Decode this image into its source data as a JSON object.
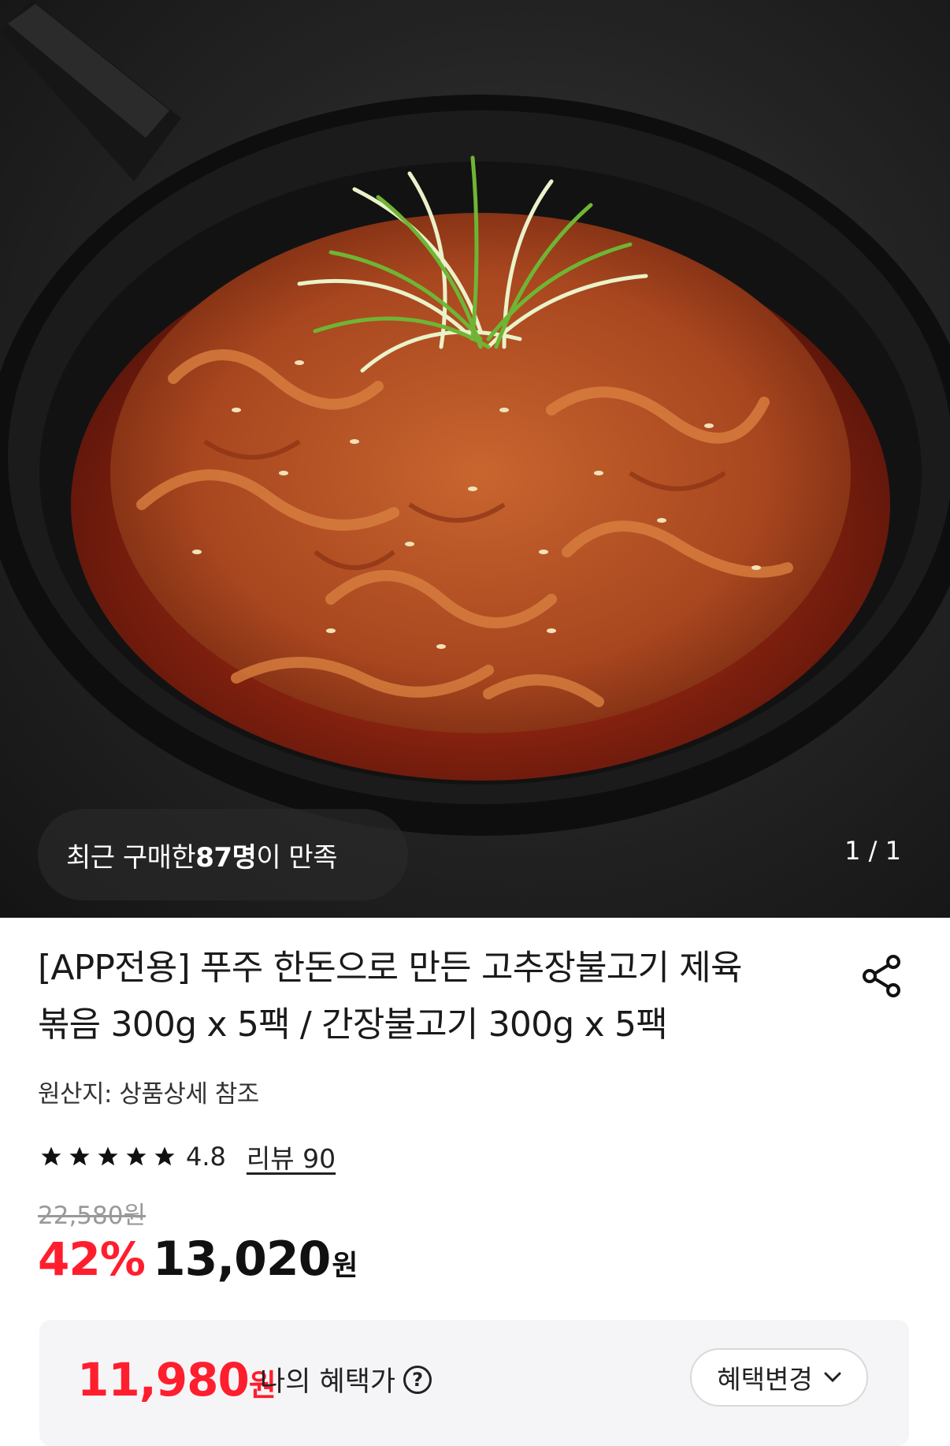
{
  "hero": {
    "purchase_prefix": "최근 구매한 ",
    "purchase_count": "87명",
    "purchase_suffix": "이 만족",
    "pager": "1 / 1"
  },
  "product": {
    "title_line1": "[APP전용] 푸주 한돈으로 만든 고추장불고기 제육",
    "title_line2": "볶음 300g x 5팩 / 간장불고기 300g x 5팩",
    "origin": "원산지: 상품상세 참조",
    "rating": "4.8",
    "review_label": "리뷰 90",
    "stars": 5,
    "original_price": "22,580원",
    "discount": "42%",
    "price": "13,020",
    "price_unit": "원"
  },
  "benefit": {
    "price": "11,980",
    "price_unit": "원",
    "label": "나의 혜택가",
    "help_symbol": "?",
    "change_button": "혜택변경"
  },
  "icons": {
    "share": "share-icon",
    "star": "star-icon",
    "help": "question-circle-icon",
    "chevron": "chevron-down-icon"
  },
  "colors": {
    "accent_red": "#ff1e2d",
    "benefit_bg": "#f5f5f7"
  }
}
